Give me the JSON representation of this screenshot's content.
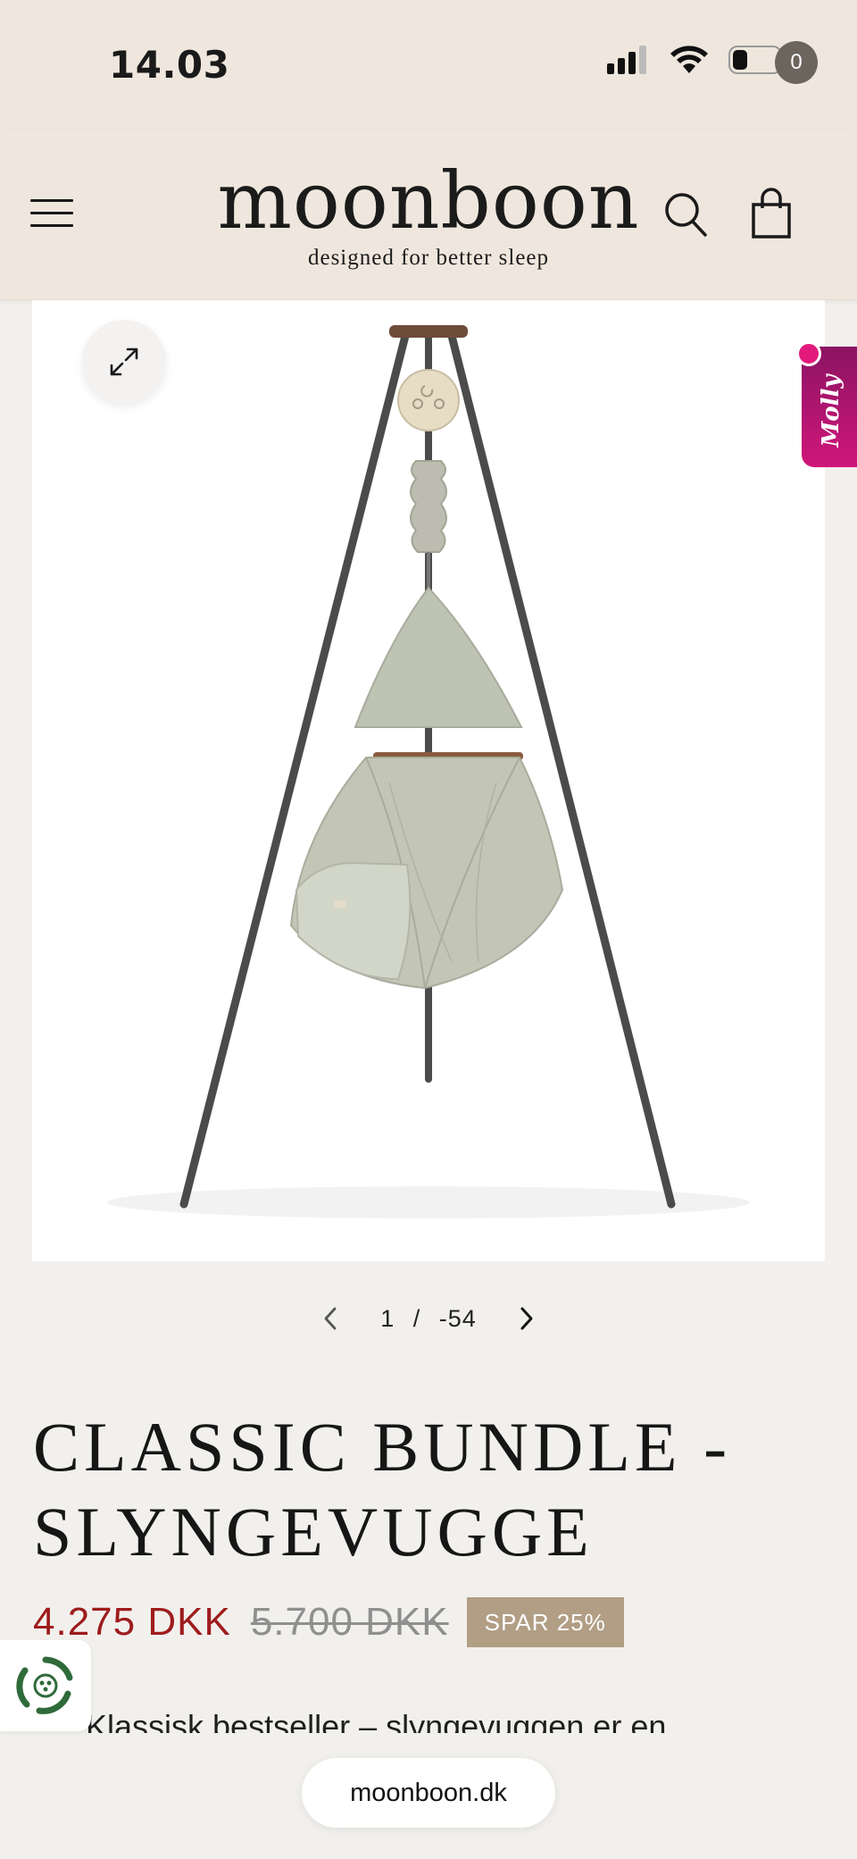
{
  "status_bar": {
    "time": "14.03"
  },
  "header": {
    "logo_main": "moonboon",
    "logo_tagline": "designed for better sleep",
    "cart_count": "0"
  },
  "gallery": {
    "current": "1",
    "separator": "/",
    "total": "-54"
  },
  "chat_widget": {
    "label": "Molly"
  },
  "product": {
    "title_line1": "CLASSIC BUNDLE -",
    "title_line2": "SLYNGEVUGGE",
    "price_now": "4.275 DKK",
    "price_old": "5.700 DKK",
    "save_badge": "SPAR 25%",
    "description_start": "Klassisk bestseller – slyngevuggen er en"
  },
  "browser": {
    "url": "moonboon.dk"
  },
  "colors": {
    "header_bg": "#efe7dd",
    "page_bg": "#f2f0ed",
    "sale_price": "#9e1c1c",
    "badge_bg": "#b19e84",
    "chat_accent": "#d0167a"
  }
}
